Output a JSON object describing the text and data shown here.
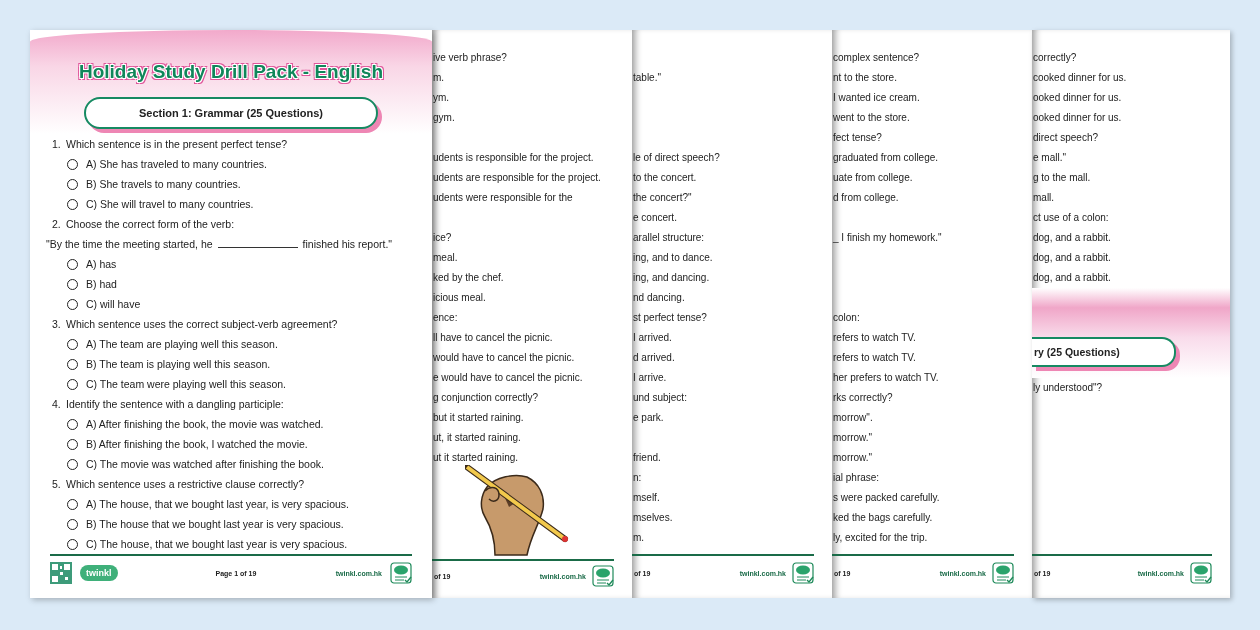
{
  "front_page": {
    "title": "Holiday Study Drill Pack - English",
    "section": "Section 1: Grammar (25 Questions)",
    "questions": [
      {
        "number": "1.",
        "text": "Which sentence is in the present perfect tense?",
        "options": [
          {
            "label": "A) She has traveled to many countries.",
            "selected": false
          },
          {
            "label": "B) She travels to many countries.",
            "selected": false
          },
          {
            "label": "C) She will travel to many countries.",
            "selected": false
          }
        ]
      },
      {
        "number": "2.",
        "text": "Choose the correct form of the verb:",
        "quote": {
          "before": "\"By the time the meeting started, he",
          "after": "finished his report.\""
        },
        "options": [
          {
            "label": "A) has",
            "selected": false
          },
          {
            "label": "B) had",
            "selected": false
          },
          {
            "label": "C) will have",
            "selected": false
          }
        ]
      },
      {
        "number": "3.",
        "text": "Which sentence uses the correct subject-verb agreement?",
        "options": [
          {
            "label": "A) The team are playing well this season.",
            "selected": false
          },
          {
            "label": "B) The team is playing well this season.",
            "selected": false
          },
          {
            "label": "C) The team were playing well this season.",
            "selected": false
          }
        ]
      },
      {
        "number": "4.",
        "text": "Identify the sentence with a dangling participle:",
        "options": [
          {
            "label": "A) After finishing the book, the movie was watched.",
            "selected": false
          },
          {
            "label": "B) After finishing the book, I watched the movie.",
            "selected": false
          },
          {
            "label": "C) The movie was watched after finishing the book.",
            "selected": false
          }
        ]
      },
      {
        "number": "5.",
        "text": "Which sentence uses a restrictive clause correctly?",
        "options": [
          {
            "label": "A) The house, that we bought last year, is very spacious.",
            "selected": false
          },
          {
            "label": "B) The house that we bought last year is very spacious.",
            "selected": false
          },
          {
            "label": "C) The house, that we bought last year is very spacious.",
            "selected": false
          }
        ]
      }
    ],
    "footer": {
      "logo": "twinkl",
      "page": "Page 1 of 19",
      "site": "twinkl.com.hk"
    }
  },
  "back_pages": [
    {
      "blocks": [
        {
          "kind": "line",
          "text": "ive verb phrase?"
        },
        {
          "kind": "line",
          "text": "m."
        },
        {
          "kind": "line",
          "text": "ym."
        },
        {
          "kind": "line",
          "text": "gym."
        },
        {
          "kind": "blank"
        },
        {
          "kind": "line",
          "text": "udents is responsible for the project."
        },
        {
          "kind": "line",
          "text": "udents are responsible for the project."
        },
        {
          "kind": "line",
          "text": "udents were responsible for the"
        },
        {
          "kind": "blank"
        },
        {
          "kind": "line",
          "text": "ice?"
        },
        {
          "kind": "line",
          "text": "meal."
        },
        {
          "kind": "line",
          "text": "ked by the chef."
        },
        {
          "kind": "line",
          "text": "icious meal."
        },
        {
          "kind": "line",
          "text": "ence:"
        },
        {
          "kind": "line",
          "text": "ll have to cancel the picnic."
        },
        {
          "kind": "line",
          "text": "would have to cancel the picnic."
        },
        {
          "kind": "line",
          "text": "e would have to cancel the picnic."
        },
        {
          "kind": "line",
          "text": "g conjunction correctly?"
        },
        {
          "kind": "line",
          "text": "but it started raining."
        },
        {
          "kind": "line",
          "text": "ut, it started raining."
        },
        {
          "kind": "line",
          "text": "ut it started raining."
        },
        {
          "kind": "drawing"
        }
      ],
      "footer": {
        "page": "of 19",
        "site": "twinkl.com.hk"
      }
    },
    {
      "blocks": [
        {
          "kind": "blank"
        },
        {
          "kind": "line",
          "text": "table.\""
        },
        {
          "kind": "blank"
        },
        {
          "kind": "blank"
        },
        {
          "kind": "blank"
        },
        {
          "kind": "line",
          "text": "le of direct speech?"
        },
        {
          "kind": "line",
          "text": "to the concert."
        },
        {
          "kind": "line",
          "text": "the concert?\""
        },
        {
          "kind": "line",
          "text": "e concert."
        },
        {
          "kind": "line",
          "text": "arallel structure:"
        },
        {
          "kind": "line",
          "text": "ing, and to dance."
        },
        {
          "kind": "line",
          "text": "ing, and dancing."
        },
        {
          "kind": "line",
          "text": "nd dancing."
        },
        {
          "kind": "line",
          "text": "st perfect tense?"
        },
        {
          "kind": "line",
          "text": "I arrived."
        },
        {
          "kind": "line",
          "text": "d arrived."
        },
        {
          "kind": "line",
          "text": "I arrive."
        },
        {
          "kind": "line",
          "text": "und subject:"
        },
        {
          "kind": "line",
          "text": "e park."
        },
        {
          "kind": "blank"
        },
        {
          "kind": "line",
          "text": "friend."
        },
        {
          "kind": "line",
          "text": "n:"
        },
        {
          "kind": "line",
          "text": "mself."
        },
        {
          "kind": "line",
          "text": "mselves."
        },
        {
          "kind": "line",
          "text": "m."
        }
      ],
      "footer": {
        "page": "of 19",
        "site": "twinkl.com.hk"
      }
    },
    {
      "blocks": [
        {
          "kind": "line",
          "text": "complex sentence?"
        },
        {
          "kind": "line",
          "text": "nt to the store."
        },
        {
          "kind": "line",
          "text": "I wanted ice cream."
        },
        {
          "kind": "line",
          "text": "went to the store."
        },
        {
          "kind": "line",
          "text": "fect tense?"
        },
        {
          "kind": "line",
          "text": "graduated from college."
        },
        {
          "kind": "line",
          "text": "uate from college."
        },
        {
          "kind": "line",
          "text": "d from college."
        },
        {
          "kind": "blank"
        },
        {
          "kind": "line",
          "text": "_ I finish my homework.\""
        },
        {
          "kind": "blank"
        },
        {
          "kind": "blank"
        },
        {
          "kind": "blank"
        },
        {
          "kind": "line",
          "text": "colon:"
        },
        {
          "kind": "line",
          "text": "refers to watch TV."
        },
        {
          "kind": "line",
          "text": "refers to watch TV."
        },
        {
          "kind": "line",
          "text": "her prefers to watch TV."
        },
        {
          "kind": "line",
          "text": "rks correctly?"
        },
        {
          "kind": "line",
          "text": "morrow\"."
        },
        {
          "kind": "line",
          "text": "morrow.\""
        },
        {
          "kind": "line",
          "text": "morrow.\""
        },
        {
          "kind": "line",
          "text": "ial phrase:"
        },
        {
          "kind": "line",
          "text": "s were packed carefully."
        },
        {
          "kind": "line",
          "text": "ked the bags carefully."
        },
        {
          "kind": "line",
          "text": "ly, excited for the trip."
        }
      ],
      "footer": {
        "page": "of 19",
        "site": "twinkl.com.hk"
      }
    },
    {
      "blocks": [
        {
          "kind": "line",
          "text": "correctly?"
        },
        {
          "kind": "line",
          "text": "cooked dinner for us."
        },
        {
          "kind": "line",
          "text": "ooked dinner for us."
        },
        {
          "kind": "line",
          "text": "ooked dinner for us."
        },
        {
          "kind": "line",
          "text": "direct speech?"
        },
        {
          "kind": "line",
          "text": "e mall.\""
        },
        {
          "kind": "line",
          "text": "g to the mall."
        },
        {
          "kind": "line",
          "text": "mall."
        },
        {
          "kind": "line",
          "text": "ct use of a colon:"
        },
        {
          "kind": "line",
          "text": "dog, and a rabbit."
        },
        {
          "kind": "line",
          "text": "dog, and a rabbit."
        },
        {
          "kind": "line",
          "text": "dog, and a rabbit."
        },
        {
          "kind": "section",
          "text": "ry (25 Questions)"
        },
        {
          "kind": "line",
          "text": "ly understood\"?"
        }
      ],
      "footer": {
        "page": "of 19",
        "site": "twinkl.com.hk"
      }
    }
  ]
}
